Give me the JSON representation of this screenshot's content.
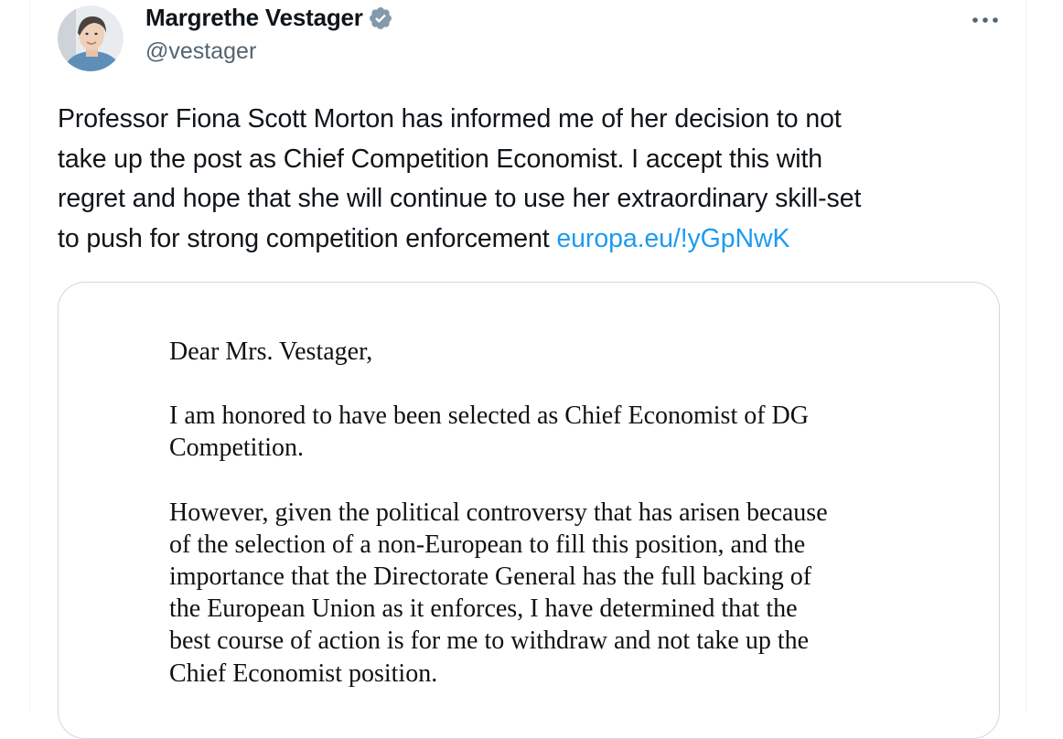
{
  "author": {
    "display_name": "Margrethe Vestager",
    "handle": "@vestager",
    "verified": true,
    "avatar_icon": "profile-photo"
  },
  "actions": {
    "more_icon": "more-horizontal-icon"
  },
  "tweet": {
    "lines": [
      "Professor Fiona Scott Morton has informed me of her decision to not",
      "take up the post as Chief Competition Economist. I accept this with",
      "regret and hope that she will continue to use her extraordinary skill-set",
      "to push for strong competition enforcement"
    ],
    "link_text": "europa.eu/!yGpNwK"
  },
  "attachment": {
    "greeting": "Dear Mrs. Vestager,",
    "paragraph1": [
      "I am honored to have been selected as Chief Economist of DG",
      "Competition."
    ],
    "paragraph2": [
      "However, given the political controversy that has arisen because",
      "of the selection of a non-European to fill this position, and the",
      "importance that the Directorate General has the full backing of",
      "the European Union as it enforces, I have determined that the",
      "best course of action is for me to withdraw and not take up the",
      "Chief Economist position."
    ]
  },
  "colors": {
    "text": "#0f1419",
    "secondary": "#536471",
    "link": "#1d9bf0",
    "verified_badge": "#829aab",
    "card_border": "#cfd9de"
  }
}
